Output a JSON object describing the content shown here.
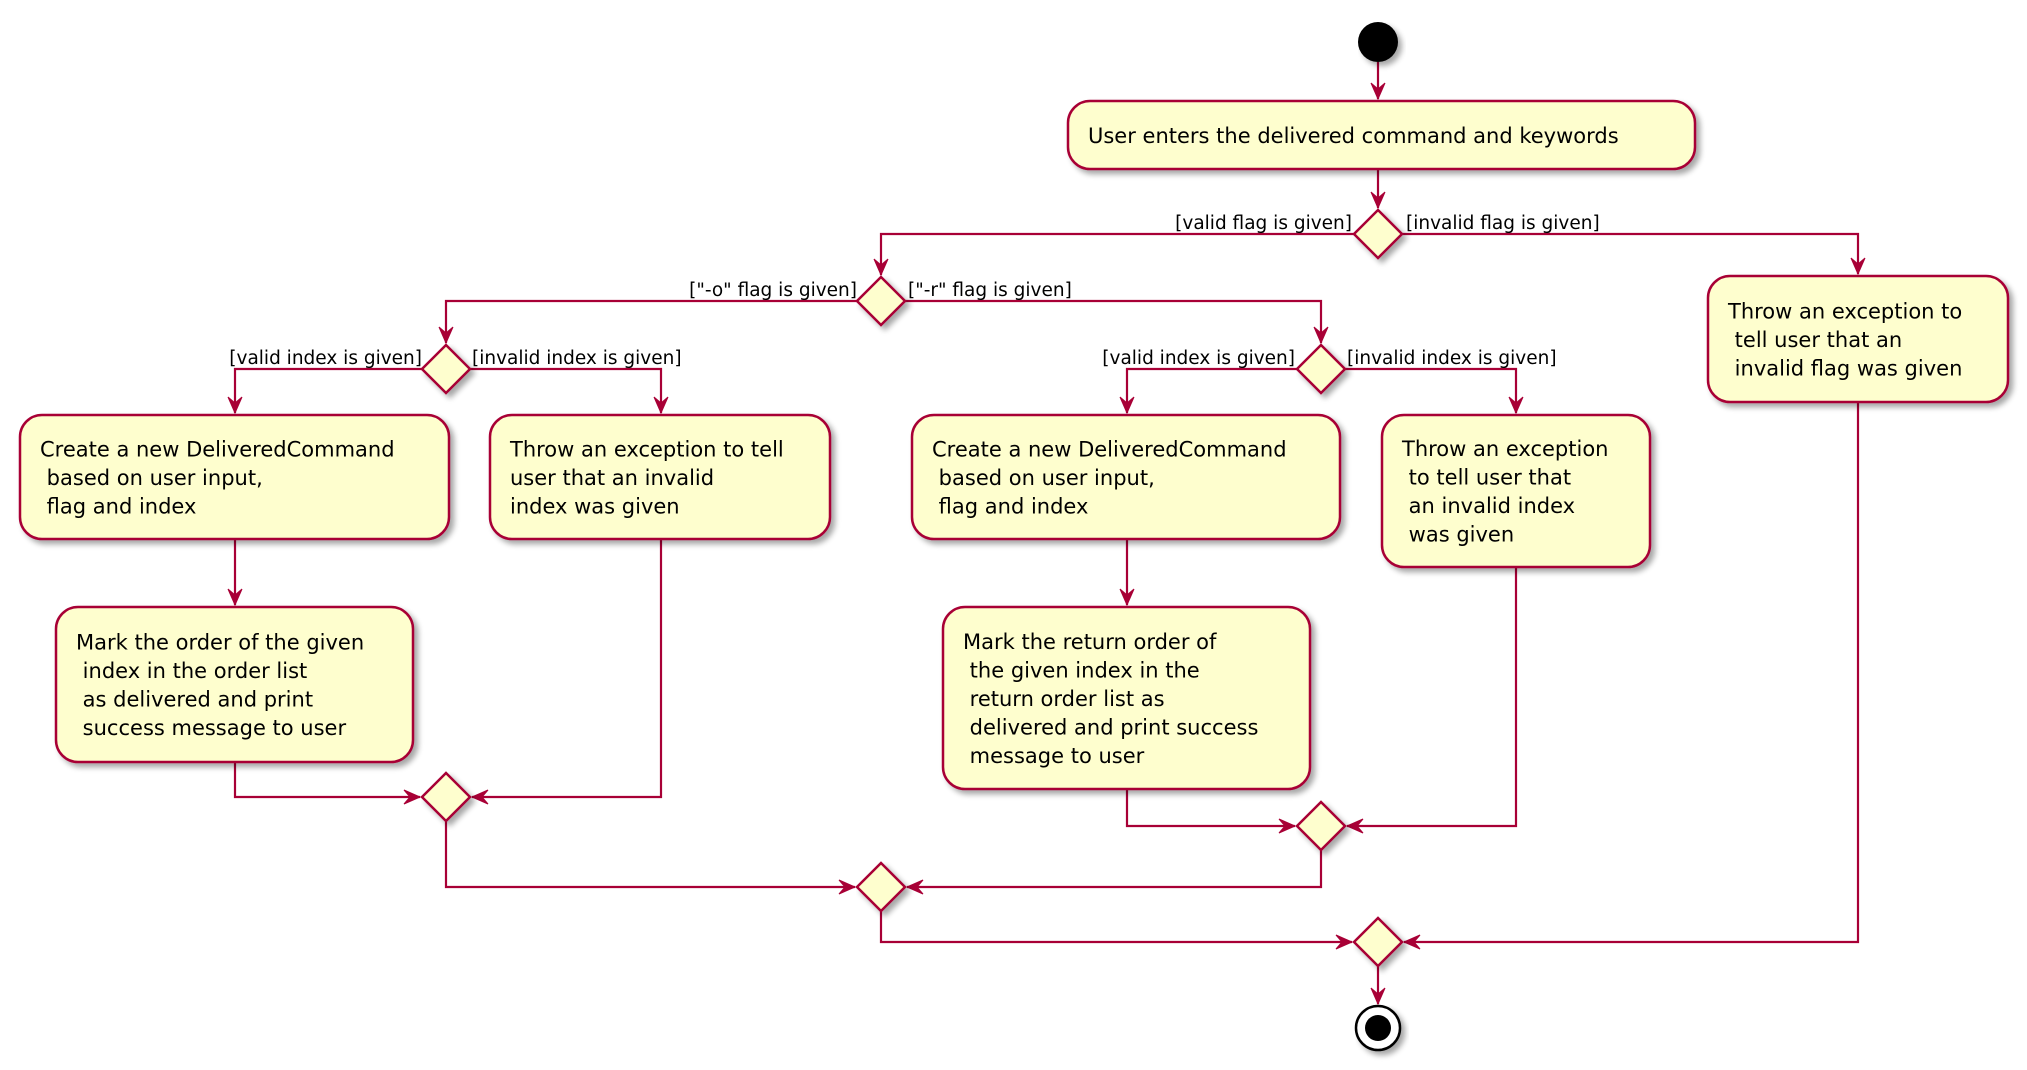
{
  "diagram": {
    "type": "uml-activity",
    "colors": {
      "border": "#A80036",
      "fill": "#FEFECE",
      "text": "#000000",
      "start": "#000000"
    },
    "nodes": {
      "start": {
        "kind": "start"
      },
      "enter_command": {
        "kind": "action",
        "lines": [
          "User enters the delivered command and keywords"
        ]
      },
      "flag_decision": {
        "kind": "decision"
      },
      "invalid_flag_action": {
        "kind": "action",
        "lines": [
          "Throw an exception to",
          " tell user that an",
          " invalid flag was given"
        ]
      },
      "flag_type_decision": {
        "kind": "decision"
      },
      "o_index_decision": {
        "kind": "decision"
      },
      "o_create_command": {
        "kind": "action",
        "lines": [
          "Create a new DeliveredCommand",
          " based on user input,",
          " flag and index"
        ]
      },
      "o_invalid_index": {
        "kind": "action",
        "lines": [
          "Throw an exception to tell",
          "user that an invalid",
          "index was given"
        ]
      },
      "o_mark_order": {
        "kind": "action",
        "lines": [
          "Mark the order of the given",
          " index in the order list",
          " as delivered and print",
          " success message to user"
        ]
      },
      "o_merge": {
        "kind": "merge"
      },
      "r_index_decision": {
        "kind": "decision"
      },
      "r_create_command": {
        "kind": "action",
        "lines": [
          "Create a new DeliveredCommand",
          " based on user input,",
          " flag and index"
        ]
      },
      "r_invalid_index": {
        "kind": "action",
        "lines": [
          "Throw an exception",
          " to tell user that",
          " an invalid index",
          " was given"
        ]
      },
      "r_mark_return_order": {
        "kind": "action",
        "lines": [
          "Mark the return order of",
          " the given index in the",
          " return order list as",
          " delivered and print success",
          " message to user"
        ]
      },
      "r_merge": {
        "kind": "merge"
      },
      "flag_type_merge": {
        "kind": "merge"
      },
      "final_merge": {
        "kind": "merge"
      },
      "end": {
        "kind": "end"
      }
    },
    "guards": {
      "valid_flag": "[valid flag is given]",
      "invalid_flag": "[invalid flag is given]",
      "o_flag": "[\"-o\" flag is given]",
      "r_flag": "[\"-r\" flag is given]",
      "o_valid_index": "[valid index is given]",
      "o_invalid_index": "[invalid index is given]",
      "r_valid_index": "[valid index is given]",
      "r_invalid_index": "[invalid index is given]"
    }
  }
}
